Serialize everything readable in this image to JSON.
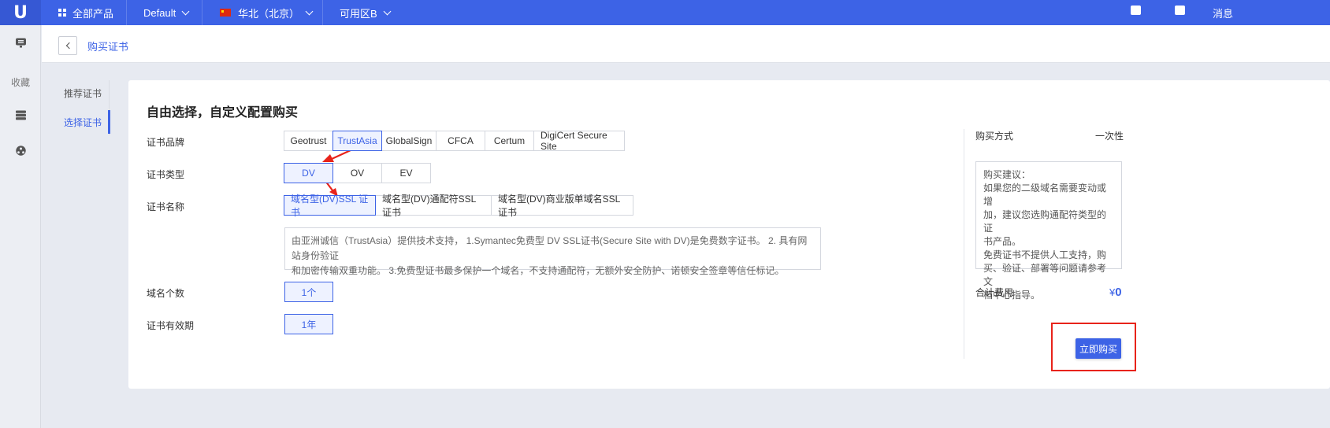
{
  "topbar": {
    "all_products": "全部产品",
    "project": "Default",
    "region": "华北（北京）",
    "zone": "可用区B",
    "messages": "消息"
  },
  "rail": {
    "favorites": "收藏"
  },
  "breadcrumb": {
    "title": "购买证书"
  },
  "submenu": {
    "items": [
      "推荐证书",
      "选择证书"
    ]
  },
  "main": {
    "title": "自由选择，自定义配置购买",
    "labels": {
      "brand": "证书品牌",
      "type": "证书类型",
      "name": "证书名称",
      "domains": "域名个数",
      "validity": "证书有效期"
    },
    "brands": [
      "Geotrust",
      "TrustAsia",
      "GlobalSign",
      "CFCA",
      "Certum",
      "DigiCert Secure Site"
    ],
    "selected_brand": "TrustAsia",
    "types": [
      "DV",
      "OV",
      "EV"
    ],
    "selected_type": "DV",
    "names": [
      "域名型(DV)SSL 证书",
      "域名型(DV)通配符SSL证书",
      "域名型(DV)商业版单域名SSL证书"
    ],
    "selected_name": "域名型(DV)SSL 证书",
    "description_line1": "由亚洲诚信（TrustAsia）提供技术支持， 1.Symantec免费型 DV SSL证书(Secure Site with DV)是免费数字证书。 2. 具有网站身份验证",
    "description_line2": "和加密传输双重功能。 3.免费型证书最多保护一个域名，不支持通配符，无额外安全防护、诺顿安全签章等信任标记。",
    "domain_count": "1个",
    "validity": "1年"
  },
  "summary": {
    "buy_method_label": "购买方式",
    "buy_method_value": "一次性",
    "advice_lines": [
      "购买建议：",
      "如果您的二级域名需要变动或增",
      "加，建议您选购通配符类型的证",
      "书产品。",
      "免费证书不提供人工支持，购",
      "买、验证、部署等问题请参考文",
      "档中心指导。"
    ],
    "total_label": "合计费用",
    "currency": "¥",
    "total_value": "0",
    "buy_button": "立即购买"
  },
  "colors": {
    "accent": "#3d63e6",
    "annotation_red": "#e8231a"
  }
}
